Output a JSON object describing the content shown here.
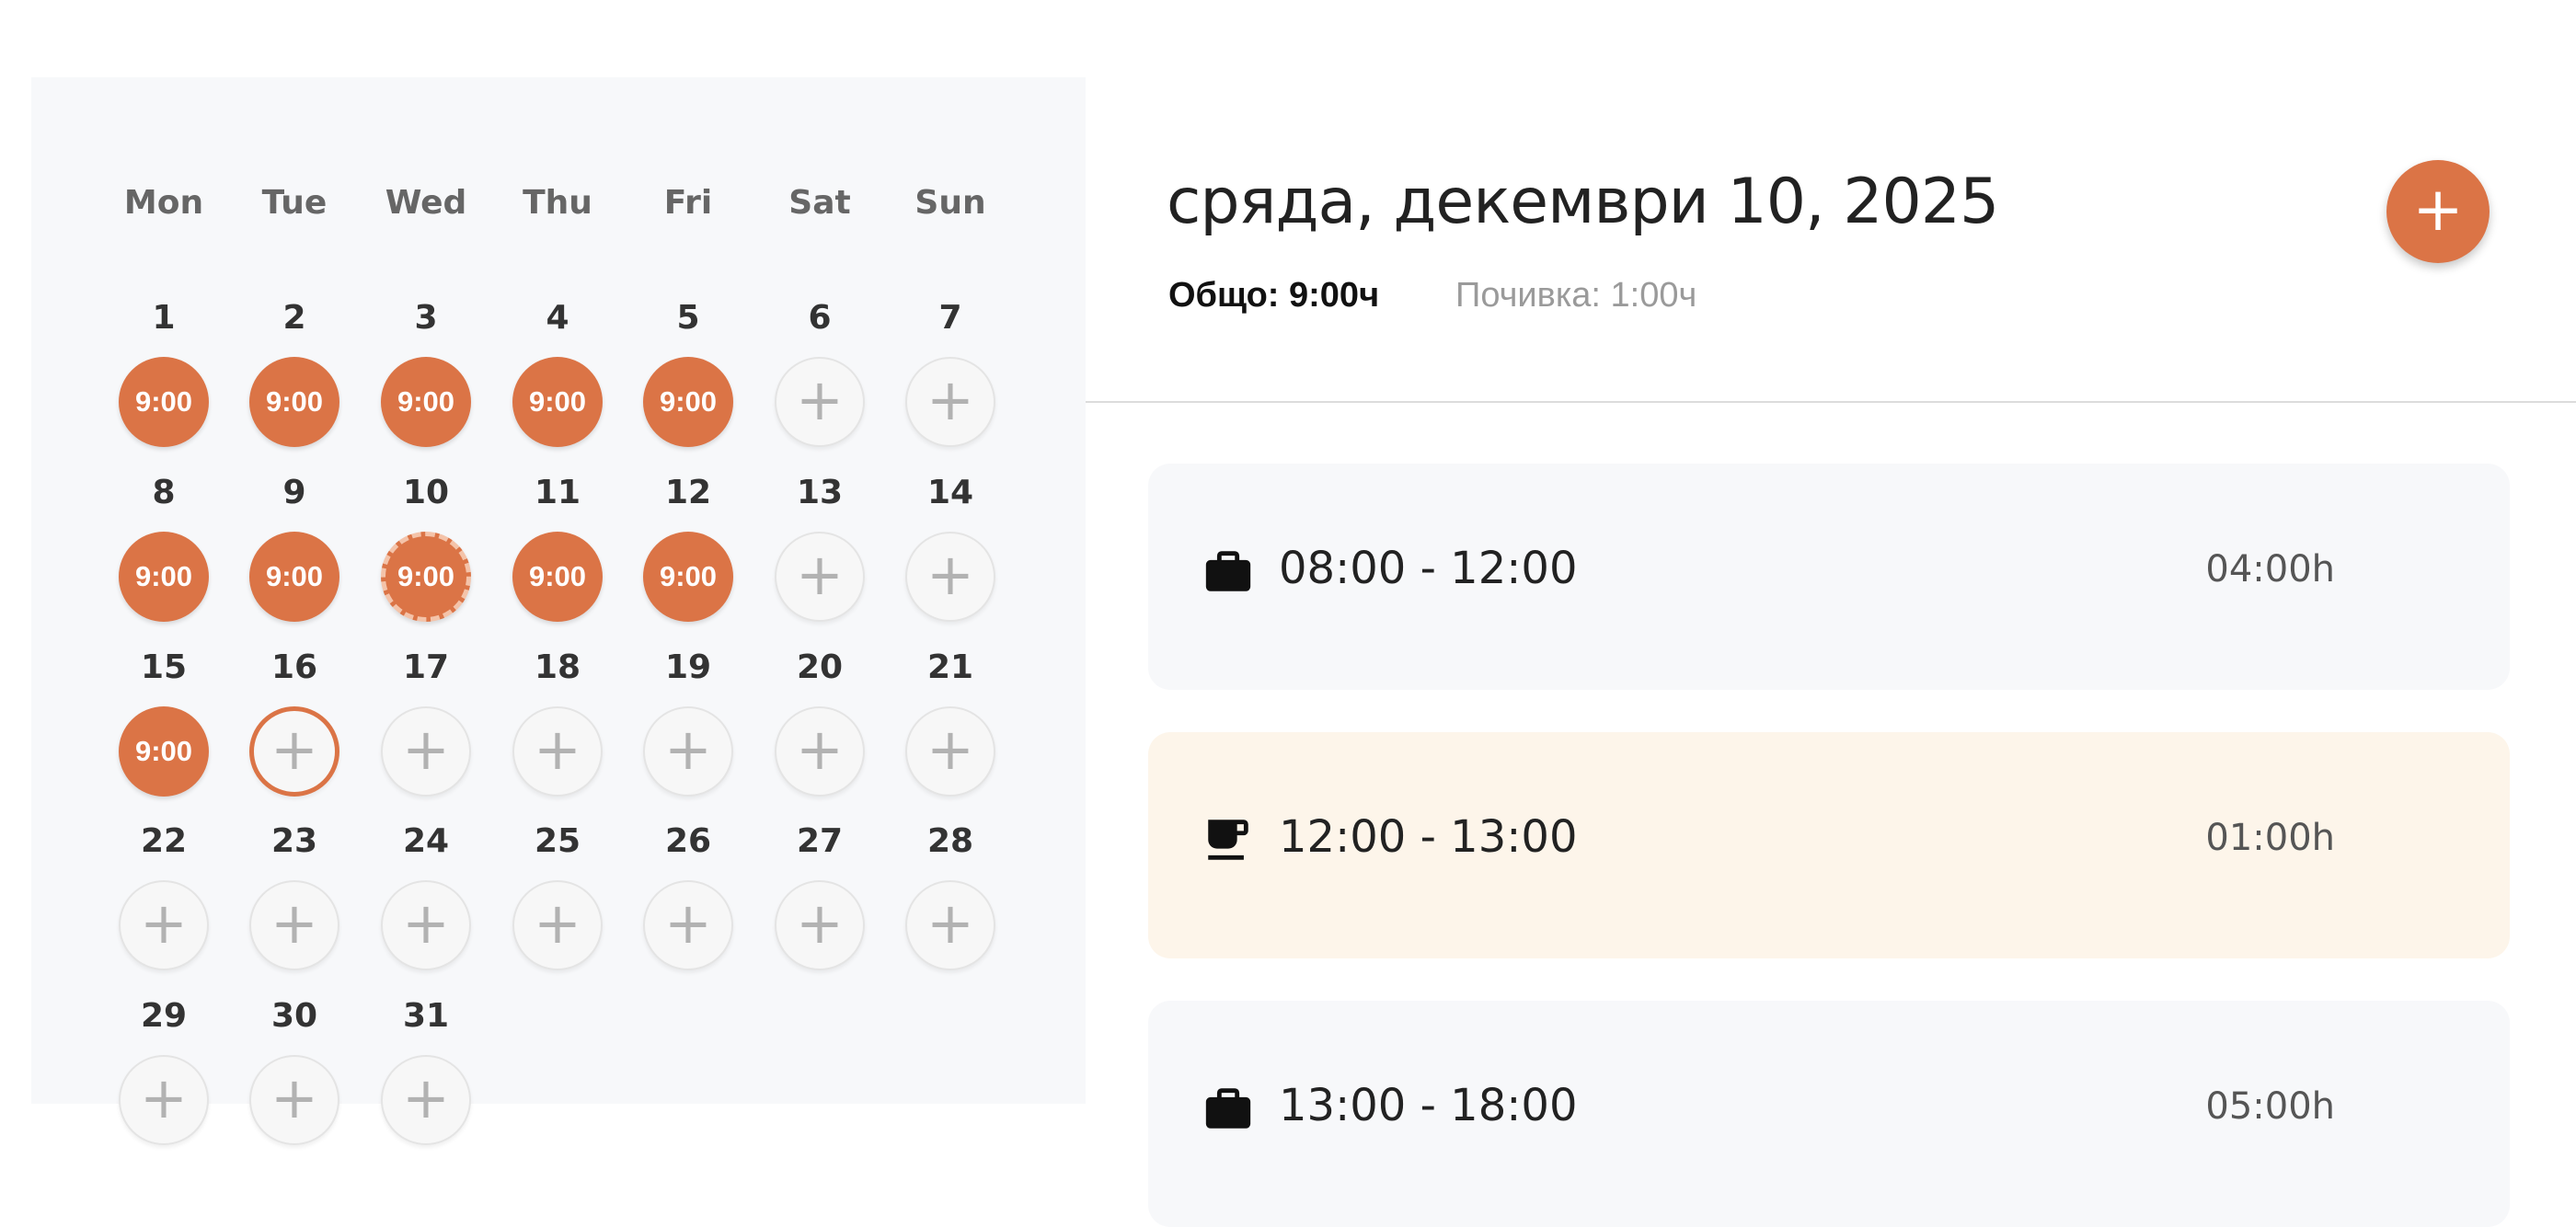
{
  "calendar": {
    "weekdays": [
      "Mon",
      "Tue",
      "Wed",
      "Thu",
      "Fri",
      "Sat",
      "Sun"
    ],
    "days": [
      {
        "day": "1",
        "hours": "9:00"
      },
      {
        "day": "2",
        "hours": "9:00"
      },
      {
        "day": "3",
        "hours": "9:00"
      },
      {
        "day": "4",
        "hours": "9:00"
      },
      {
        "day": "5",
        "hours": "9:00"
      },
      {
        "day": "6",
        "hours": null
      },
      {
        "day": "7",
        "hours": null
      },
      {
        "day": "8",
        "hours": "9:00"
      },
      {
        "day": "9",
        "hours": "9:00"
      },
      {
        "day": "10",
        "hours": "9:00",
        "selected": true
      },
      {
        "day": "11",
        "hours": "9:00"
      },
      {
        "day": "12",
        "hours": "9:00"
      },
      {
        "day": "13",
        "hours": null
      },
      {
        "day": "14",
        "hours": null
      },
      {
        "day": "15",
        "hours": "9:00"
      },
      {
        "day": "16",
        "hours": null,
        "today": true
      },
      {
        "day": "17",
        "hours": null
      },
      {
        "day": "18",
        "hours": null
      },
      {
        "day": "19",
        "hours": null
      },
      {
        "day": "20",
        "hours": null
      },
      {
        "day": "21",
        "hours": null
      },
      {
        "day": "22",
        "hours": null
      },
      {
        "day": "23",
        "hours": null
      },
      {
        "day": "24",
        "hours": null
      },
      {
        "day": "25",
        "hours": null
      },
      {
        "day": "26",
        "hours": null
      },
      {
        "day": "27",
        "hours": null
      },
      {
        "day": "28",
        "hours": null
      },
      {
        "day": "29",
        "hours": null
      },
      {
        "day": "30",
        "hours": null
      },
      {
        "day": "31",
        "hours": null
      }
    ],
    "add_symbol": "+"
  },
  "day_detail": {
    "title": "сряда, декември 10, 2025",
    "total": "Общо: 9:00ч",
    "break": "Почивка: 1:00ч",
    "add_symbol": "+",
    "entries": [
      {
        "type": "work",
        "icon": "briefcase-icon",
        "time": "08:00 - 12:00",
        "duration": "04:00h"
      },
      {
        "type": "break",
        "icon": "coffee-cup-icon",
        "time": "12:00 - 13:00",
        "duration": "01:00h"
      },
      {
        "type": "work",
        "icon": "briefcase-icon",
        "time": "13:00 - 18:00",
        "duration": "05:00h"
      }
    ]
  },
  "colors": {
    "accent": "#db7446",
    "panel_bg": "#f7f8fa",
    "break_bg": "#fdf5ea"
  }
}
